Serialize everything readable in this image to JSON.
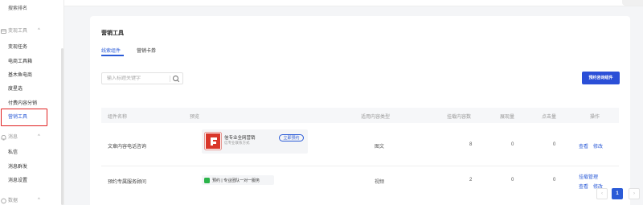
{
  "sidebar": {
    "top_item": "搜索排名",
    "groups": [
      {
        "label": "变现工具",
        "icon": "wallet-icon",
        "items": [
          "变现任务",
          "电商工具箱",
          "基木鱼电商",
          "度星选",
          "付费内容分销",
          "营销工具"
        ]
      },
      {
        "label": "消息",
        "icon": "bell-icon",
        "items": [
          "私信",
          "消息群发",
          "消息设置"
        ]
      },
      {
        "label": "数据",
        "icon": "chart-icon",
        "items": []
      }
    ],
    "active_item": "营销工具"
  },
  "page": {
    "title": "营销工具",
    "tabs": [
      {
        "label": "线索组件",
        "active": true
      },
      {
        "label": "营销卡券",
        "active": false
      }
    ],
    "search": {
      "placeholder": "输入标题关键字"
    },
    "create_button": "预约咨询组件"
  },
  "table": {
    "columns": [
      "组件名称",
      "预览",
      "适用内容类型",
      "挂载内容数",
      "展现量",
      "点击量",
      "操作"
    ],
    "rows": [
      {
        "name": "文章内容电话咨询",
        "preview": {
          "type": "card",
          "title": "信专业全网营销",
          "subtitle": "信专业联系方式",
          "button": "立即预约"
        },
        "content_type": "图文",
        "mounted": "8",
        "impressions": "0",
        "clicks": "0",
        "actions": [
          "查看",
          "修改"
        ]
      },
      {
        "name": "预约专属服务顾问",
        "preview": {
          "type": "chip",
          "text": "预约 | 专业团队一对一服务"
        },
        "content_type": "视频",
        "mounted": "2",
        "impressions": "0",
        "clicks": "0",
        "actions": [
          "挂载管理",
          "查看",
          "修改"
        ]
      }
    ]
  },
  "pagination": {
    "prev": "‹",
    "current": "1",
    "next": "›"
  },
  "colors": {
    "accent": "#2b5bd7",
    "highlight_border": "#e02020",
    "chip_icon": "#2bb44a",
    "logo": "#d9362a"
  }
}
